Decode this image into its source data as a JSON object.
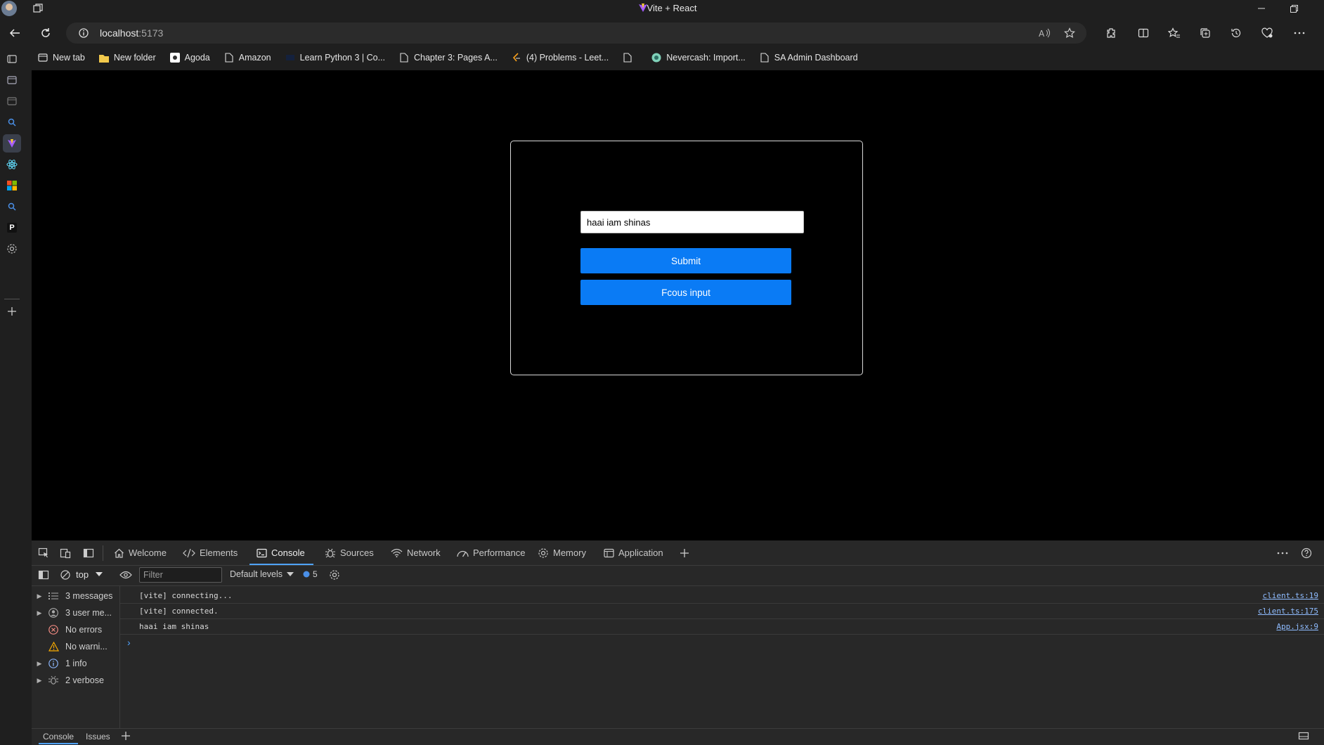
{
  "window": {
    "title": "Vite + React"
  },
  "address": {
    "host": "localhost",
    "port": ":5173"
  },
  "bookmarks": [
    {
      "label": "New tab",
      "icon": "new-tab-icon"
    },
    {
      "label": "New folder",
      "icon": "folder-icon"
    },
    {
      "label": "Agoda",
      "icon": "agoda-icon"
    },
    {
      "label": "Amazon",
      "icon": "page-icon"
    },
    {
      "label": "Learn Python 3 | Co...",
      "icon": "codecademy-icon"
    },
    {
      "label": "Chapter 3: Pages A...",
      "icon": "page-icon"
    },
    {
      "label": "(4) Problems - Leet...",
      "icon": "leetcode-icon"
    },
    {
      "label": "",
      "icon": "page-icon"
    },
    {
      "label": "Nevercash: Import...",
      "icon": "nevercash-icon"
    },
    {
      "label": "SA Admin Dashboard",
      "icon": "page-icon"
    }
  ],
  "app": {
    "input_value": "haai iam shinas",
    "submit_label": "Submit",
    "focus_label": "Fcous input"
  },
  "devtools": {
    "tabs": [
      {
        "label": "Welcome",
        "icon": "home-icon"
      },
      {
        "label": "Elements",
        "icon": "code-icon"
      },
      {
        "label": "Console",
        "icon": "console-icon",
        "active": true
      },
      {
        "label": "Sources",
        "icon": "bug-icon"
      },
      {
        "label": "Network",
        "icon": "wifi-icon"
      },
      {
        "label": "Performance",
        "icon": "performance-icon"
      },
      {
        "label": "Memory",
        "icon": "memory-icon"
      },
      {
        "label": "Application",
        "icon": "application-icon"
      }
    ],
    "context": "top",
    "filter_placeholder": "Filter",
    "levels": "Default levels",
    "issues_count": "5",
    "sidebar_filters": [
      {
        "label": "3 messages",
        "icon": "list-icon",
        "expandable": true
      },
      {
        "label": "3 user me...",
        "icon": "user-icon",
        "expandable": true
      },
      {
        "label": "No errors",
        "icon": "error-icon",
        "expandable": false
      },
      {
        "label": "No warni...",
        "icon": "warning-icon",
        "expandable": false
      },
      {
        "label": "1 info",
        "icon": "info-icon",
        "expandable": true
      },
      {
        "label": "2 verbose",
        "icon": "verbose-icon",
        "expandable": true
      }
    ],
    "logs": [
      {
        "message": "[vite] connecting...",
        "source": "client.ts:19"
      },
      {
        "message": "[vite] connected.",
        "source": "client.ts:175"
      },
      {
        "message": "haai iam shinas",
        "source": "App.jsx:9"
      }
    ],
    "prompt_symbol": "›",
    "bottom_tabs": [
      "Console",
      "Issues"
    ]
  },
  "colors": {
    "accent": "#0a7bf5",
    "devtools_tab_indicator": "#4fa3ff"
  }
}
